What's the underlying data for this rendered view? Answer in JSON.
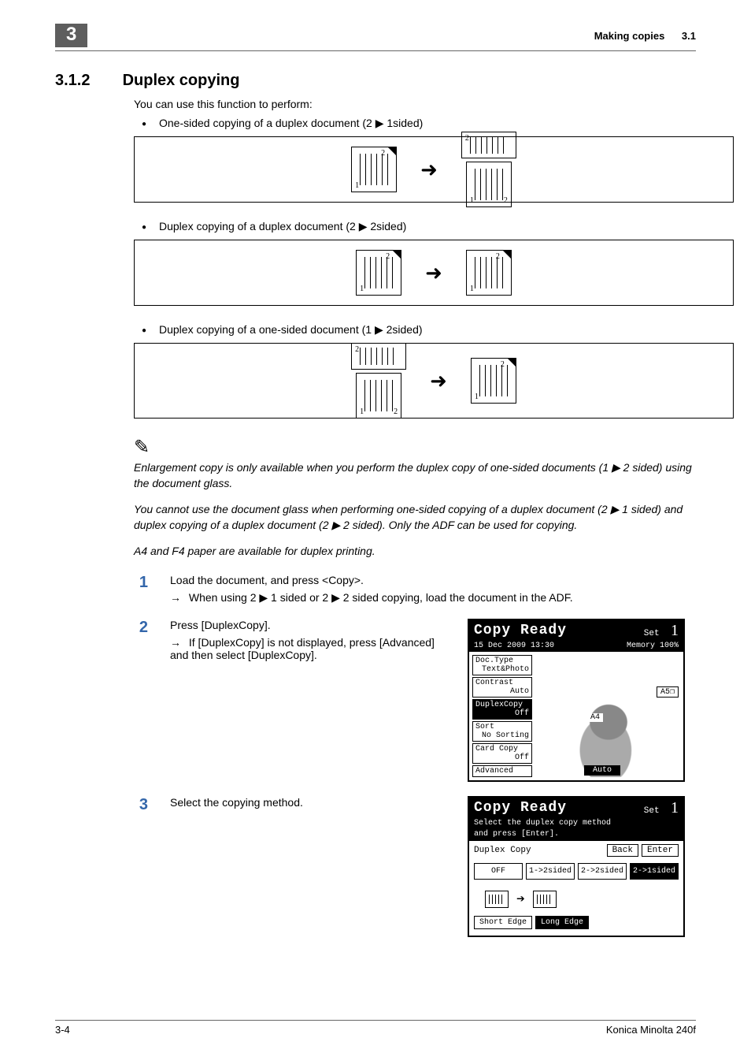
{
  "header": {
    "chapter_number": "3",
    "title": "Making copies",
    "section": "3.1"
  },
  "heading": {
    "number": "3.1.2",
    "text": "Duplex copying"
  },
  "intro": "You can use this function to perform:",
  "bullets": {
    "b1": "One-sided copying of a duplex document (2 ▶ 1sided)",
    "b2": "Duplex copying of a duplex document (2 ▶ 2sided)",
    "b3": "Duplex copying of a one-sided document (1 ▶ 2sided)"
  },
  "diagram_labels": {
    "one": "1",
    "two": "2"
  },
  "notes": {
    "n1": "Enlargement copy is only available when you perform the duplex copy of one-sided documents (1 ▶ 2 sided) using the document glass.",
    "n2": "You cannot use the document glass when performing one-sided copying of a duplex document (2 ▶ 1 sided) and duplex copying of a duplex document (2 ▶ 2 sided). Only the ADF can be used for copying.",
    "n3": "A4 and F4 paper are available for duplex printing."
  },
  "steps": {
    "s1": {
      "num": "1",
      "text": "Load the document, and press <Copy>.",
      "sub": "When using 2 ▶ 1 sided or 2 ▶ 2 sided copying, load the document in the ADF."
    },
    "s2": {
      "num": "2",
      "text": "Press [DuplexCopy].",
      "sub": "If [DuplexCopy] is not displayed, press [Advanced] and then select [DuplexCopy]."
    },
    "s3": {
      "num": "3",
      "text": "Select the copying method."
    }
  },
  "lcd1": {
    "title": "Copy Ready",
    "set": "Set",
    "n": "1",
    "date": "15 Dec 2009 13:30",
    "memory": "Memory",
    "pct": "100%",
    "left": {
      "doctype": "Doc.Type",
      "doctype_v": "Text&Photo",
      "contrast": "Contrast",
      "contrast_v": "Auto",
      "duplex": "DuplexCopy",
      "duplex_v": "Off",
      "sort": "Sort",
      "sort_v": "No Sorting",
      "card": "Card Copy",
      "card_v": "Off",
      "advanced": "Advanced"
    },
    "a5": "A5❐",
    "a4": "A4",
    "auto": "Auto"
  },
  "lcd2": {
    "title": "Copy Ready",
    "set": "Set",
    "n": "1",
    "sub1": "Select the duplex copy method",
    "sub2": "and press [Enter].",
    "label": "Duplex Copy",
    "back": "Back",
    "enter": "Enter",
    "opts": {
      "off": "OFF",
      "o1": "1->2sided",
      "o2": "2->2sided",
      "o3": "2->1sided"
    },
    "edge_short": "Short Edge",
    "edge_long": "Long Edge"
  },
  "footer": {
    "page": "3-4",
    "product": "Konica Minolta 240f"
  }
}
